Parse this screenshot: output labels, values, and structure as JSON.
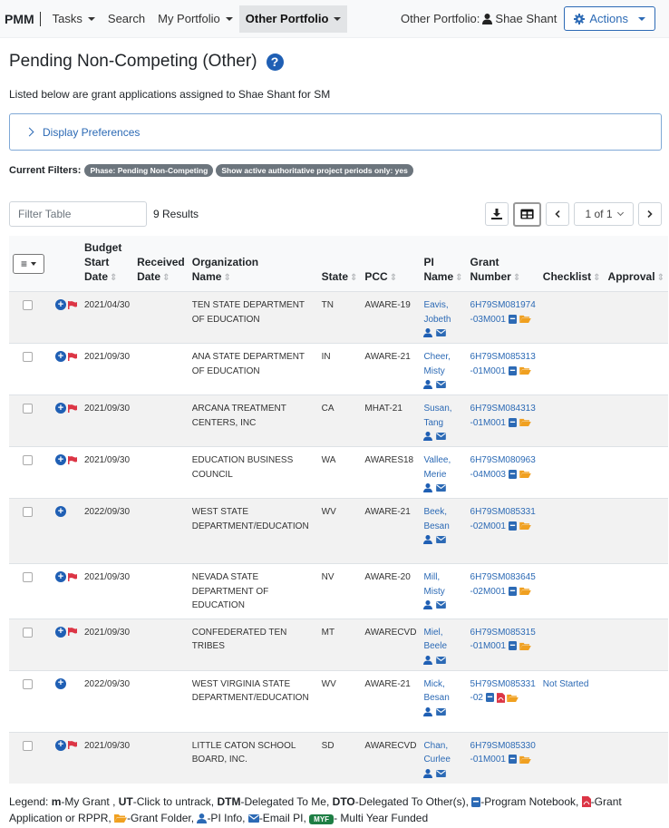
{
  "navbar": {
    "brand": "PMM",
    "items": [
      {
        "label": "Tasks",
        "dropdown": true,
        "active": false
      },
      {
        "label": "Search",
        "dropdown": false,
        "active": false
      },
      {
        "label": "My Portfolio",
        "dropdown": true,
        "active": false
      },
      {
        "label": "Other Portfolio",
        "dropdown": true,
        "active": true
      }
    ],
    "portfolio_label": "Other Portfolio:",
    "portfolio_user": "Shae Shant",
    "actions_label": "Actions"
  },
  "page": {
    "title": "Pending Non-Competing (Other)",
    "help_icon": "question-circle-icon",
    "subtitle": "Listed below are grant applications assigned to Shae Shant for SM",
    "display_preferences": "Display Preferences",
    "filters_label": "Current Filters:",
    "filters": [
      "Phase: Pending Non-Competing",
      "Show active authoritative project periods only: yes"
    ]
  },
  "toolbar": {
    "filter_placeholder": "Filter Table",
    "filter_value": "",
    "results": "9 Results",
    "page_select": "1 of 1",
    "download_icon": "download-icon",
    "columns_icon": "table-columns-icon",
    "prev_icon": "chevron-left-icon",
    "next_icon": "chevron-right-icon"
  },
  "table": {
    "columns": [
      {
        "key": "select",
        "label": ""
      },
      {
        "key": "icons",
        "label": ""
      },
      {
        "key": "budget_start",
        "label": "Budget Start Date",
        "lines": [
          "Budget",
          "Start",
          "Date"
        ]
      },
      {
        "key": "received",
        "label": "Received Date",
        "lines": [
          "Received",
          "Date"
        ]
      },
      {
        "key": "org",
        "label": "Organization Name",
        "lines": [
          "Organization",
          "Name"
        ]
      },
      {
        "key": "state",
        "label": "State",
        "lines": [
          "State"
        ]
      },
      {
        "key": "pcc",
        "label": "PCC",
        "lines": [
          "PCC"
        ]
      },
      {
        "key": "pi",
        "label": "PI Name",
        "lines": [
          "PI",
          "Name"
        ]
      },
      {
        "key": "grant",
        "label": "Grant Number",
        "lines": [
          "Grant",
          "Number"
        ]
      },
      {
        "key": "checklist",
        "label": "Checklist",
        "lines": [
          "Checklist"
        ]
      },
      {
        "key": "approval",
        "label": "Approval",
        "lines": [
          "Approval"
        ]
      }
    ],
    "rows": [
      {
        "flag": true,
        "budget_start": "2021/04/30",
        "received": "",
        "org": "TEN STATE DEPARTMENT OF EDUCATION",
        "state": "TN",
        "pcc": "AWARE-19",
        "pi": "Eavis, Jobeth",
        "grant_a": "6H79SM081974",
        "grant_b": "-03M001",
        "pdf": false,
        "checklist": "",
        "approval": ""
      },
      {
        "flag": true,
        "budget_start": "2021/09/30",
        "received": "",
        "org": "ANA STATE DEPARTMENT OF EDUCATION",
        "state": "IN",
        "pcc": "AWARE-21",
        "pi": "Cheer, Misty",
        "grant_a": "6H79SM085313",
        "grant_b": "-01M001",
        "pdf": false,
        "checklist": "",
        "approval": ""
      },
      {
        "flag": true,
        "budget_start": "2021/09/30",
        "received": "",
        "org": "ARCANA TREATMENT CENTERS, INC",
        "state": "CA",
        "pcc": "MHAT-21",
        "pi": "Susan, Tang",
        "grant_a": "6H79SM084313",
        "grant_b": "-01M001",
        "pdf": false,
        "checklist": "",
        "approval": ""
      },
      {
        "flag": true,
        "budget_start": "2021/09/30",
        "received": "",
        "org": "EDUCATION BUSINESS COUNCIL",
        "state": "WA",
        "pcc": "AWARES18",
        "pi": "Vallee, Merie",
        "grant_a": "6H79SM080963",
        "grant_b": "-04M003",
        "pdf": false,
        "checklist": "",
        "approval": ""
      },
      {
        "flag": false,
        "budget_start": "2022/09/30",
        "received": "",
        "org": "WEST STATE DEPARTMENT/EDUCATION",
        "state": "WV",
        "pcc": "AWARE-21",
        "pi": "Beek, Besan",
        "grant_a": "6H79SM085331",
        "grant_b": "-02M001",
        "pdf": false,
        "checklist": "",
        "approval": ""
      },
      {
        "flag": true,
        "budget_start": "2021/09/30",
        "received": "",
        "org": "NEVADA STATE DEPARTMENT OF EDUCATION",
        "state": "NV",
        "pcc": "AWARE-20",
        "pi": "Mill, Misty",
        "grant_a": "6H79SM083645",
        "grant_b": "-02M001",
        "pdf": false,
        "checklist": "",
        "approval": ""
      },
      {
        "flag": true,
        "budget_start": "2021/09/30",
        "received": "",
        "org": "CONFEDERATED TEN TRIBES",
        "state": "MT",
        "pcc": "AWARECVD",
        "pi": "Miel, Beele",
        "grant_a": "6H79SM085315",
        "grant_b": "-01M001",
        "pdf": false,
        "checklist": "",
        "approval": ""
      },
      {
        "flag": false,
        "budget_start": "2022/09/30",
        "received": "",
        "org": "WEST VIRGINIA STATE DEPARTMENT/EDUCATION",
        "state": "WV",
        "pcc": "AWARE-21",
        "pi": "Mick, Besan",
        "grant_a": "5H79SM085331",
        "grant_b": "-02",
        "pdf": true,
        "checklist": "Not Started",
        "approval": ""
      },
      {
        "flag": true,
        "budget_start": "2021/09/30",
        "received": "",
        "org": "LITTLE CATON SCHOOL BOARD, INC.",
        "state": "SD",
        "pcc": "AWARECVD",
        "pi": "Chan, Curlee",
        "grant_a": "6H79SM085330",
        "grant_b": "-01M001",
        "pdf": false,
        "checklist": "",
        "approval": ""
      }
    ]
  },
  "legend": {
    "prefix": "Legend:",
    "items": [
      {
        "key": "m",
        "text": "-My Grant ,"
      },
      {
        "key": "UT",
        "text": "-Click to untrack,"
      },
      {
        "key": "DTM",
        "text": "-Delegated To Me,"
      },
      {
        "key": "DTO",
        "text": "-Delegated To Other(s),"
      }
    ],
    "notebook": "-Program Notebook,",
    "grant_app": "-Grant Application or RPPR,",
    "folder": "-Grant Folder,",
    "pi_info": "-PI Info,",
    "email": "-Email PI,",
    "myf_badge": "MYF",
    "myf": "- Multi Year Funded"
  },
  "colors": {
    "primary": "#2c6ab5",
    "flag": "#dc3545",
    "folder": "#f0a020",
    "pdf": "#dc3545",
    "myf": "#1e7e44"
  }
}
